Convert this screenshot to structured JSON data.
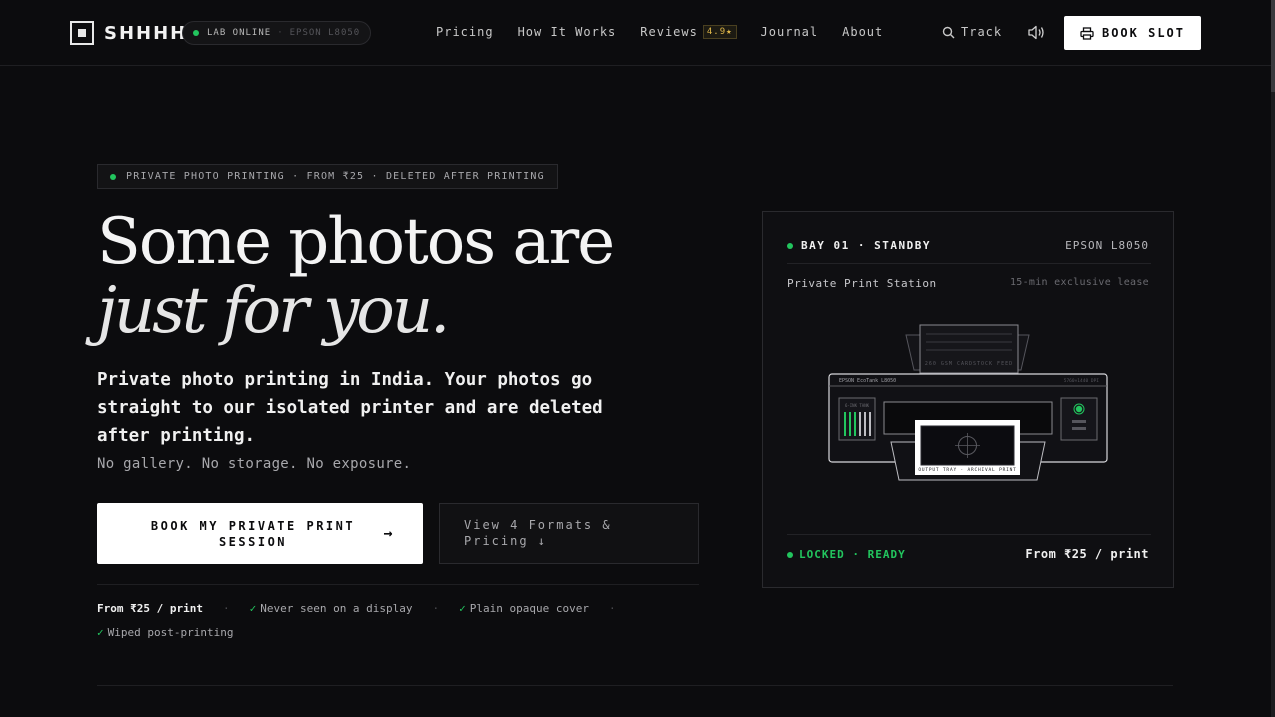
{
  "nav": {
    "brand": "SHHHH",
    "status_online": "LAB ONLINE",
    "status_sep": "·",
    "status_device": "EPSON L8050",
    "links": {
      "pricing": "Pricing",
      "how": "How It Works",
      "reviews": "Reviews",
      "rating": "4.9★",
      "journal": "Journal",
      "about": "About"
    },
    "track": "Track",
    "book_slot": "BOOK SLOT"
  },
  "hero": {
    "tag": "PRIVATE PHOTO PRINTING · FROM ₹25 · DELETED AFTER PRINTING",
    "headline_1": "Some photos are",
    "headline_2": "just for you.",
    "lead": "Private photo printing in India. Your photos go straight to our isolated printer and are deleted after printing.",
    "sub": "No gallery. No storage. No exposure.",
    "cta_primary": "BOOK MY PRIVATE PRINT SESSION",
    "cta_primary_arrow": "→",
    "cta_secondary": "View 4 Formats & Pricing ↓",
    "features": {
      "price": "From ₹25 / print",
      "f1": "Never seen on a display",
      "f2": "Plain opaque cover",
      "f3": "Wiped post-printing",
      "check": "✓",
      "sep": "·"
    }
  },
  "panel": {
    "bay": "BAY 01 · STANDBY",
    "model": "EPSON L8050",
    "station": "Private Print Station",
    "lease": "15-min exclusive lease",
    "printer": {
      "paper_label": "260 GSM CARDSTOCK FEED",
      "brand_label": "EPSON EcoTank L8050",
      "dpi_label": "5760×1440 DPI",
      "ink_label": "6-INK TANK",
      "tray_label": "OUTPUT TRAY · ARCHIVAL PRINT"
    },
    "locked": "LOCKED · READY",
    "from": "From ₹25 / print"
  },
  "colors": {
    "background": "#0c0c0e",
    "accent_green": "#22c55e",
    "rating_gold": "#e0b84a",
    "button_white": "#ffffff"
  }
}
